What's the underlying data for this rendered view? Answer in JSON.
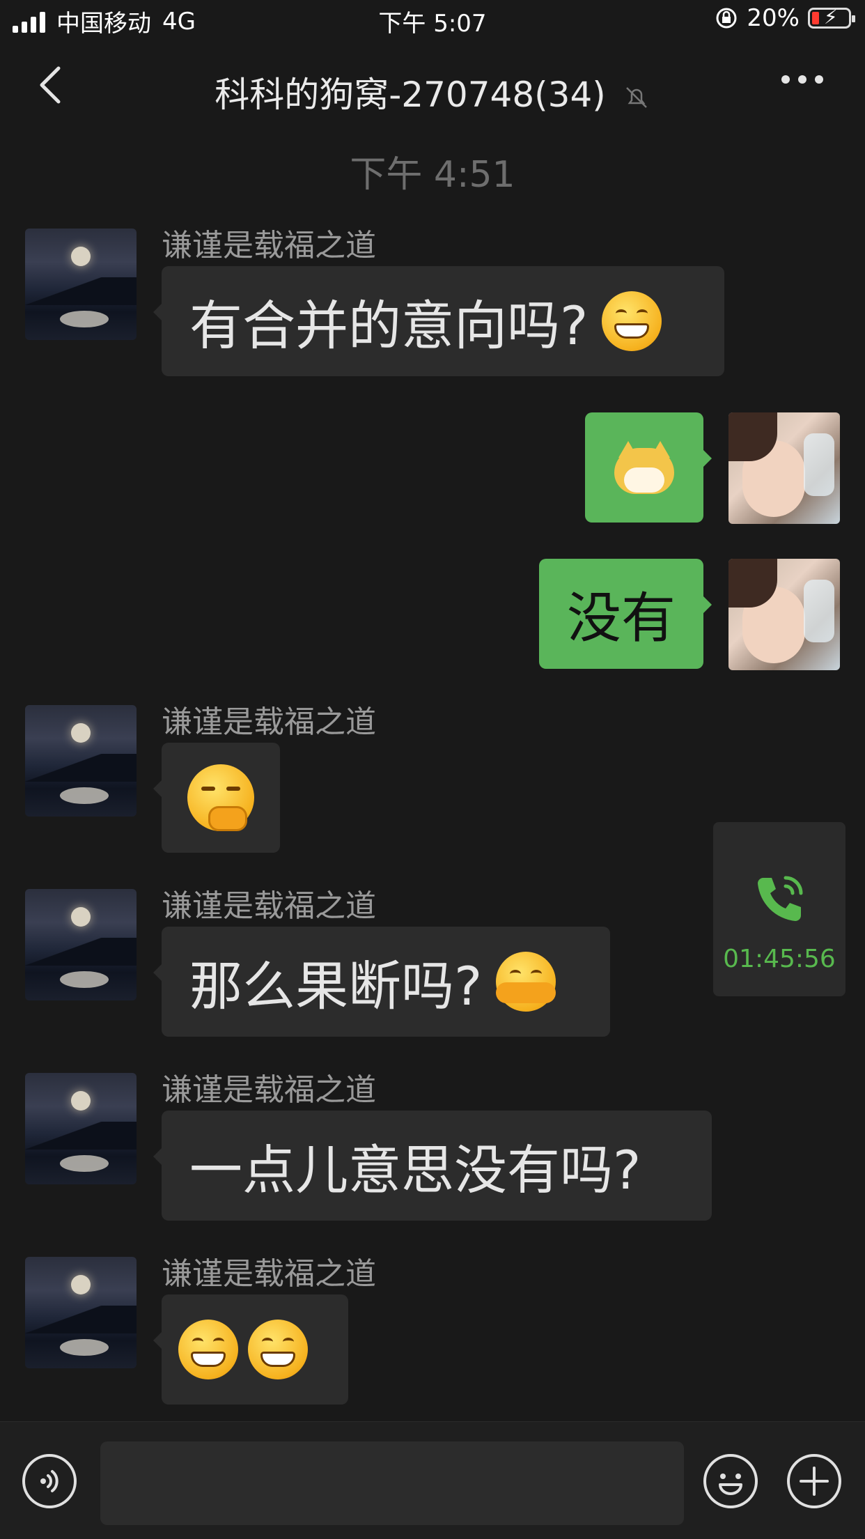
{
  "status_bar": {
    "carrier": "中国移动",
    "network": "4G",
    "time": "下午 5:07",
    "battery": "20%"
  },
  "nav": {
    "title": "科科的狗窝-270748(34)"
  },
  "timestamp": "下午 4:51",
  "messages": [
    {
      "sender": "谦谨是载福之道",
      "text": "有合并的意向吗?"
    },
    {
      "sender": "",
      "text": ""
    },
    {
      "sender": "",
      "text": "没有"
    },
    {
      "sender": "谦谨是载福之道",
      "text": ""
    },
    {
      "sender": "谦谨是载福之道",
      "text": "那么果断吗?"
    },
    {
      "sender": "谦谨是载福之道",
      "text": "一点儿意思没有吗?"
    },
    {
      "sender": "谦谨是载福之道",
      "text": ""
    }
  ],
  "call_card": {
    "duration": "01:45:56",
    "color": "#58b94e"
  },
  "colors": {
    "background": "#191919",
    "outgoing_bubble": "#5ab55a",
    "incoming_bubble": "#2c2c2c"
  },
  "icons": {
    "back": "chevron-left-icon",
    "mute": "bell-slash-icon",
    "more": "more-dots-icon",
    "voice": "voice-icon",
    "emoji": "smiley-icon",
    "plus": "plus-icon",
    "call": "phone-icon"
  }
}
